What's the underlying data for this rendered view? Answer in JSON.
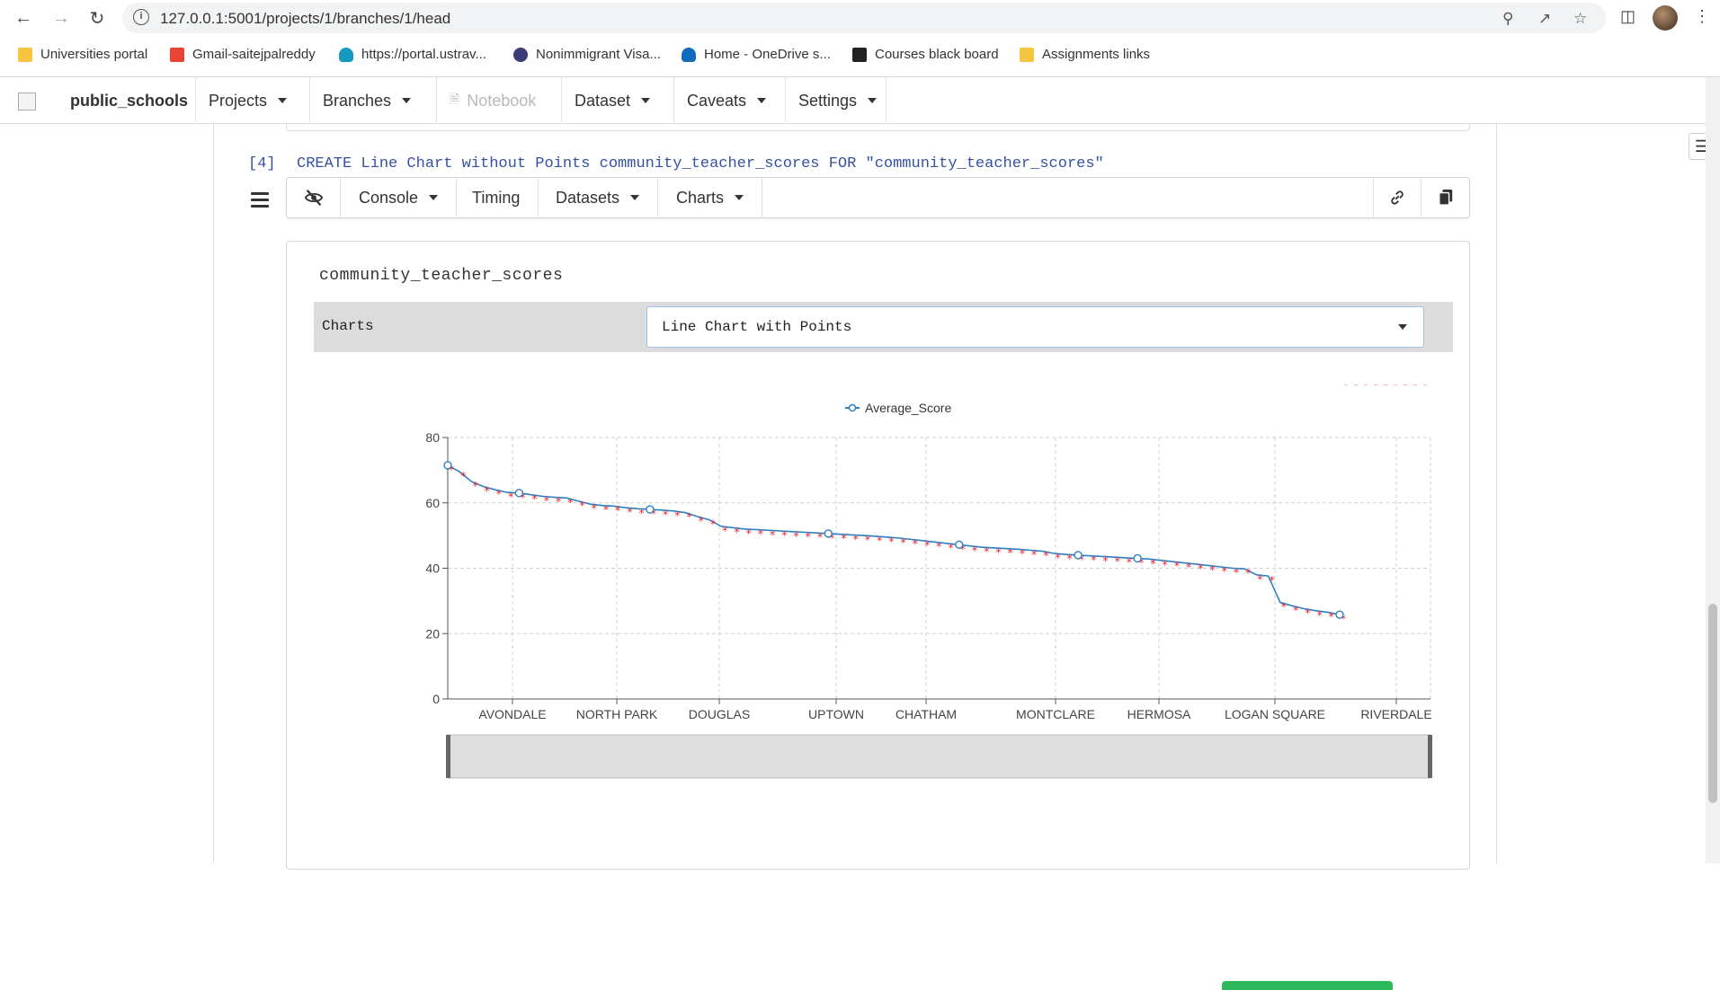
{
  "browser": {
    "url": "127.0.0.1:5001/projects/1/branches/1/head",
    "bookmarks": [
      {
        "label": "Universities portal",
        "icon": "folder-icon",
        "color": "#f5c542"
      },
      {
        "label": "Gmail-saitejpalreddy",
        "icon": "gmail-icon",
        "color": "#ea4335"
      },
      {
        "label": "https://portal.ustrav...",
        "icon": "salesforce-cloud-icon",
        "color": "#1798c1"
      },
      {
        "label": "Nonimmigrant Visa...",
        "icon": "seal-icon",
        "color": "#3b3b7a"
      },
      {
        "label": "Home - OneDrive s...",
        "icon": "onedrive-icon",
        "color": "#0f6cbd"
      },
      {
        "label": "Courses black board",
        "icon": "blackboard-icon",
        "color": "#222222"
      },
      {
        "label": "Assignments links",
        "icon": "folder-icon",
        "color": "#f5c542"
      }
    ]
  },
  "app_nav": {
    "brand": "public_schools",
    "items": [
      {
        "label": "Projects",
        "dropdown": true,
        "disabled": false
      },
      {
        "label": "Branches",
        "dropdown": true,
        "disabled": false
      },
      {
        "label": "Notebook",
        "dropdown": false,
        "disabled": true
      },
      {
        "label": "Dataset",
        "dropdown": true,
        "disabled": false
      },
      {
        "label": "Caveats",
        "dropdown": true,
        "disabled": false
      },
      {
        "label": "Settings",
        "dropdown": true,
        "disabled": false
      }
    ]
  },
  "cell": {
    "number": "[4]",
    "code": "CREATE Line Chart without Points community_teacher_scores FOR \"community_teacher_scores\"",
    "toolbar": {
      "console": "Console",
      "timing": "Timing",
      "datasets": "Datasets",
      "charts": "Charts"
    }
  },
  "output": {
    "title": "community_teacher_scores",
    "charts_label": "Charts",
    "chart_type_selected": "Line Chart with Points"
  },
  "chart_data": {
    "type": "line",
    "title": "",
    "legend": [
      "Average_Score"
    ],
    "legend_position": "top-center",
    "xlabel": "",
    "ylabel": "",
    "ylim": [
      0,
      80
    ],
    "yticks": [
      0,
      20,
      40,
      60,
      80
    ],
    "grid": true,
    "categories_labeled": [
      "AVONDALE",
      "NORTH PARK",
      "DOUGLAS",
      "UPTOWN",
      "CHATHAM",
      "MONTCLARE",
      "HERMOSA",
      "LOGAN SQUARE",
      "RIVERDALE"
    ],
    "series": [
      {
        "name": "Average_Score",
        "color": "#2f7fc1",
        "marker_color": "#e8222b",
        "values": [
          71.5,
          69.5,
          66.5,
          65,
          64,
          63.2,
          63,
          62.5,
          62,
          61.7,
          61.5,
          60.5,
          59.6,
          59.2,
          59,
          58.5,
          58.2,
          58,
          57.8,
          57.5,
          57,
          55.8,
          54.8,
          52.8,
          52.4,
          52,
          51.8,
          51.6,
          51.4,
          51.2,
          51,
          50.8,
          50.6,
          50.4,
          50.2,
          50,
          49.8,
          49.5,
          49.2,
          48.8,
          48.4,
          48,
          47.6,
          47.2,
          46.8,
          46.4,
          46.2,
          46,
          45.8,
          45.5,
          45.2,
          44.5,
          44.2,
          44,
          43.8,
          43.6,
          43.4,
          43.2,
          43,
          42.8,
          42.4,
          42,
          41.6,
          41.2,
          40.8,
          40.4,
          40,
          39.8,
          38,
          37.6,
          29.5,
          28.5,
          27.6,
          27,
          26.5,
          25.8
        ]
      }
    ]
  }
}
